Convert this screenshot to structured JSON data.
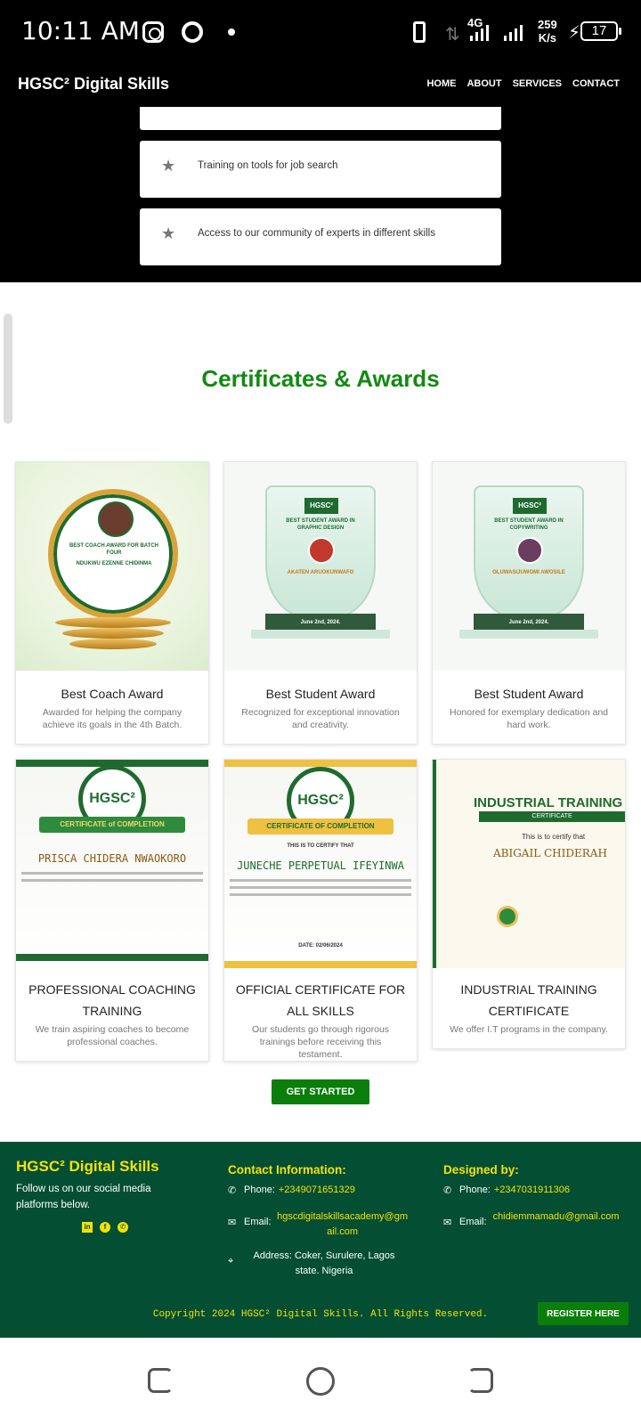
{
  "status_bar": {
    "time": "10:11 AM",
    "network": "4G",
    "speed_value": "259",
    "speed_unit": "K/s",
    "battery": "17"
  },
  "nav": {
    "brand": "HGSC² Digital Skills",
    "links": [
      "HOME",
      "ABOUT",
      "SERVICES",
      "CONTACT"
    ]
  },
  "features": {
    "items": [
      {
        "icon": "star-icon",
        "text": "Training on tools for job search"
      },
      {
        "icon": "star-icon",
        "text": "Access to our community of experts in different skills"
      }
    ]
  },
  "certificates": {
    "title": "Certificates & Awards",
    "cards": [
      {
        "title": "Best Coach Award",
        "desc": "Awarded for helping the company achieve its goals in the 4th Batch."
      },
      {
        "title": "Best Student Award",
        "desc": "Recognized for exceptional innovation and creativity."
      },
      {
        "title": "Best Student Award",
        "desc": "Honored for exemplary dedication and hard work."
      },
      {
        "title": "PROFESSIONAL COACHING TRAINING",
        "desc": "We train aspiring coaches to become professional coaches."
      },
      {
        "title": "OFFICIAL CERTIFICATE FOR ALL SKILLS",
        "desc": "Our students go through rigorous trainings before receiving this testament."
      },
      {
        "title": "INDUSTRIAL TRAINING CERTIFICATE",
        "desc": "We offer I.T programs in the company."
      }
    ],
    "images": {
      "coach": {
        "heading": "BEST COACH AWARD FOR BATCH FOUR",
        "name": "NDUKWU EZENNE CHIDINMA"
      },
      "student1": {
        "logo": "HGSC²",
        "heading": "BEST STUDENT AWARD IN GRAPHIC DESIGN",
        "name": "AKATEN ARUOKUNWAFO",
        "date": "June 2nd, 2024."
      },
      "student2": {
        "logo": "HGSC²",
        "heading": "BEST STUDENT AWARD IN COPYWRITING",
        "name": "OLUWASIJUWOMI AWOSILE",
        "date": "June 2nd, 2024."
      },
      "coaching": {
        "logo": "HGSC²",
        "ribbon": "CERTIFICATE of COMPLETION",
        "name": "PRISCA CHIDERA NWAOKORO"
      },
      "official": {
        "logo": "HGSC²",
        "ribbon": "CERTIFICATE OF COMPLETION",
        "certify": "THIS IS TO CERTIFY THAT",
        "name": "JUNECHE PERPETUAL IFEYINWA",
        "date": "DATE: 02/06/2024"
      },
      "industrial": {
        "heading": "INDUSTRIAL TRAINING",
        "sub": "CERTIFICATE",
        "certify": "This is to certify that",
        "name": "ABIGAIL CHIDERAH"
      }
    },
    "cta": "GET STARTED"
  },
  "footer": {
    "brand": "HGSC² Digital Skills",
    "follow_text": "Follow us on our social media platforms below.",
    "social_icons": [
      "linkedin-icon",
      "facebook-icon",
      "whatsapp-icon"
    ],
    "contact": {
      "heading": "Contact Information:",
      "phone_label": "Phone:",
      "phone": "+2349071651329",
      "email_label": "Email:",
      "email": "hgscdigitalskillsacademy@gmail.com",
      "address_label": "Address:",
      "address": "Coker, Surulere, Lagos state. Nigeria"
    },
    "designer": {
      "heading": "Designed by:",
      "phone_label": "Phone:",
      "phone": "+2347031911306",
      "email_label": "Email:",
      "email": "chidiemmamadu@gmail.com"
    },
    "copyright": "Copyright 2024 HGSC² Digital Skills. All Rights Reserved.",
    "register": "REGISTER HERE"
  },
  "colors": {
    "accent_green": "#138a12",
    "footer_bg": "#044f33",
    "footer_text_accent": "#f2e10c",
    "button_green": "#0a7d0a"
  }
}
